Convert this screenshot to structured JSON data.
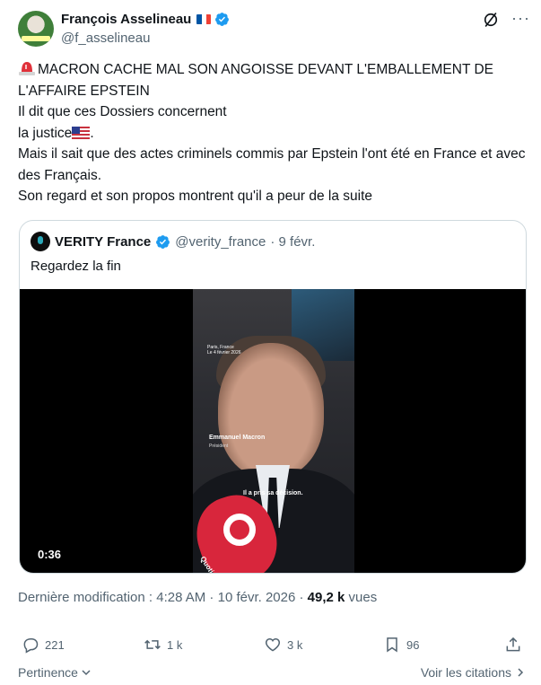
{
  "author": {
    "name": "François Asselineau",
    "handle": "@f_asselineau",
    "flag_colors": [
      "#0055a4",
      "#ffffff",
      "#ef4135"
    ]
  },
  "tweet": {
    "line1": "MACRON CACHE MAL SON ANGOISSE DEVANT L'EMBALLEMENT  DE L'AFFAIRE EPSTEIN",
    "line2": "Il dit que ces Dossiers concernent",
    "line3a": "la justice",
    "line3b": ".",
    "line4": "Mais il sait que des actes criminels commis par Epstein l'ont été en France et avec des Français.",
    "line5": "Son regard et son propos montrent qu'il a peur de la suite"
  },
  "quote": {
    "name": "VERITY France",
    "handle": "@verity_france",
    "date": "· 9 févr.",
    "text": "Regardez la fin",
    "video": {
      "location": "Paris, France",
      "location_date": "Le 4 février 2026",
      "person_name": "Emmanuel Macron",
      "person_role": "Président",
      "subtitle": "Il a pris sa décision.",
      "mic_label": "Quotidien",
      "duration": "0:36"
    }
  },
  "meta": {
    "prefix": "Dernière modification : 4:28 AM · 10 févr. 2026 · ",
    "views": "49,2 k",
    "views_label": " vues"
  },
  "actions": {
    "replies": "221",
    "reposts": "1 k",
    "likes": "3 k",
    "bookmarks": "96"
  },
  "footer": {
    "sort_label": "Pertinence",
    "quotes_link": "Voir les citations"
  },
  "colors": {
    "verified_blue": "#1d9bf0",
    "text_primary": "#0f1419",
    "text_secondary": "#536471",
    "border": "#cfd9de"
  }
}
